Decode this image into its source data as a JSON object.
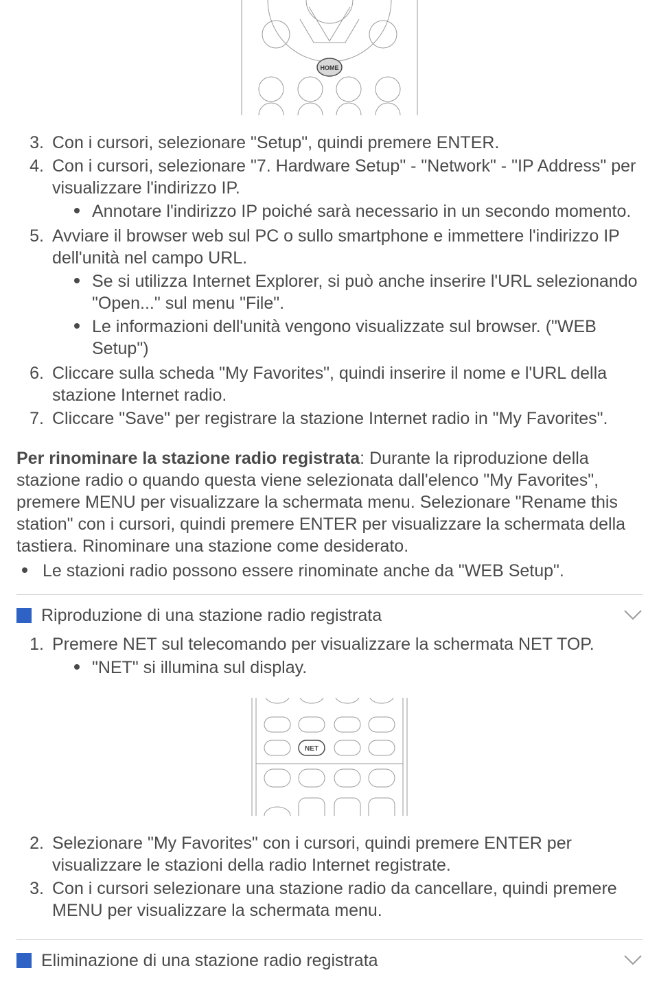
{
  "figure1": {
    "home_label": "HOME"
  },
  "steps_a": [
    {
      "num": "3.",
      "text": "Con i cursori, selezionare \"Setup\", quindi premere ENTER.",
      "sub": []
    },
    {
      "num": "4.",
      "text": "Con i cursori, selezionare \"7. Hardware Setup\" - \"Network\" - \"IP Address\" per visualizzare l'indirizzo IP.",
      "sub": [
        "Annotare l'indirizzo IP poiché sarà necessario in un secondo momento."
      ]
    },
    {
      "num": "5.",
      "text": "Avviare il browser web sul PC o sullo smartphone e immettere l'indirizzo IP dell'unità nel campo URL.",
      "sub": [
        "Se si utilizza Internet Explorer, si può anche inserire l'URL selezionando \"Open...\" sul menu \"File\".",
        "Le informazioni dell'unità vengono visualizzate sul browser. (\"WEB Setup\")"
      ]
    },
    {
      "num": "6.",
      "text": "Cliccare sulla scheda \"My Favorites\", quindi inserire il nome e l'URL della stazione Internet radio.",
      "sub": []
    },
    {
      "num": "7.",
      "text": "Cliccare \"Save\" per registrare la stazione Internet radio in \"My Favorites\".",
      "sub": []
    }
  ],
  "rename_block": {
    "bold": "Per rinominare la stazione radio registrata",
    "rest": ": Durante la riproduzione della stazione radio o quando questa viene selezionata dall'elenco \"My Favorites\", premere MENU per visualizzare la schermata menu. Selezionare \"Rename this station\" con i cursori, quindi premere ENTER per visualizzare la schermata della tastiera. Rinominare una stazione come desiderato.",
    "bullets": [
      "Le stazioni radio possono essere rinominate anche da \"WEB Setup\"."
    ]
  },
  "section_play": {
    "title": "Riproduzione di una stazione radio registrata",
    "steps": [
      {
        "num": "1.",
        "text": "Premere NET sul telecomando per visualizzare la schermata NET TOP.",
        "sub": [
          "\"NET\" si illumina sul display."
        ]
      }
    ],
    "steps_after": [
      {
        "num": "2.",
        "text": "Selezionare \"My Favorites\" con i cursori, quindi premere ENTER per visualizzare le stazioni della radio Internet registrate.",
        "sub": []
      },
      {
        "num": "3.",
        "text": "Con i cursori selezionare una stazione radio da cancellare, quindi premere MENU per visualizzare la schermata menu.",
        "sub": []
      }
    ]
  },
  "figure2": {
    "net_label": "NET"
  },
  "section_delete": {
    "title": "Eliminazione di una stazione radio registrata"
  }
}
